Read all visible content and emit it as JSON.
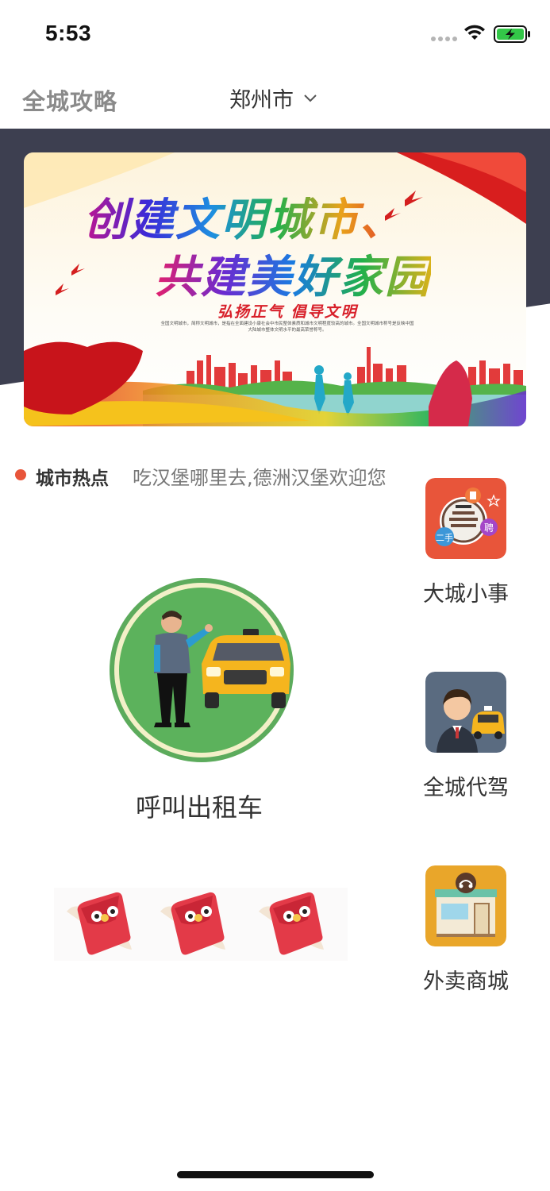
{
  "status_bar": {
    "time": "5:53"
  },
  "nav": {
    "title": "全城攻略",
    "city": "郑州市"
  },
  "banner": {
    "line1": "创建文明城市、",
    "line2": "共建美好家园",
    "slogan": "弘扬正气 倡导文明",
    "small_text": "全国文明城市，简称文明城市，是指在全面建设小康社会中市民整体素质和城市文明程度较高的城市。全国文明城市称号是反映中国大陆城市整体文明水平的最高荣誉称号。"
  },
  "hot_news": {
    "label": "城市热点",
    "text": "吃汉堡哪里去,德洲汉堡欢迎您"
  },
  "taxi": {
    "label": "呼叫出租车"
  },
  "services": [
    {
      "label": "大城小事",
      "icon": "city-news-icon"
    },
    {
      "label": "全城代驾",
      "icon": "chauffeur-icon"
    },
    {
      "label": "外卖商城",
      "icon": "delivery-shop-icon"
    }
  ],
  "colors": {
    "accent_dot": "#e8553a",
    "dark_band": "#3d3f50",
    "taxi_ring": "#5cab5c"
  }
}
